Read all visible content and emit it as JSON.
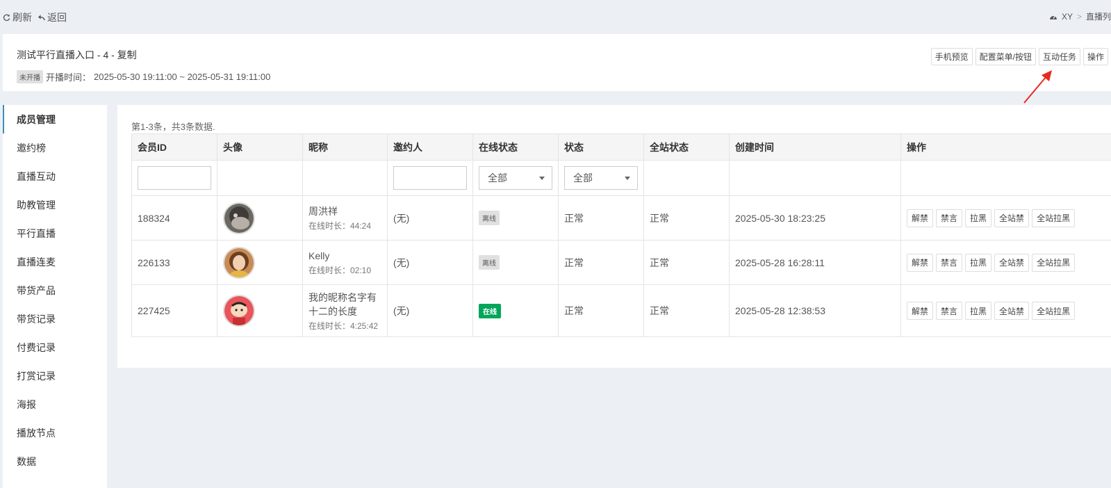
{
  "toolbar": {
    "refresh_label": "刷新",
    "back_label": "返回"
  },
  "breadcrumb": {
    "home": "XY",
    "separator": ">",
    "current": "直播列"
  },
  "live": {
    "title": "测试平行直播入口 - 4 - 复制",
    "status_badge": "未开播",
    "time_label": "开播时间：",
    "time_range": "2025-05-30 19:11:00 ~ 2025-05-31 19:11:00"
  },
  "header_actions": {
    "mobile_preview": "手机预览",
    "config_menu": "配置菜单/按钮",
    "interaction_task": "互动任务",
    "operate": "操作"
  },
  "sidebar": {
    "items": [
      {
        "label": "成员管理"
      },
      {
        "label": "邀约榜"
      },
      {
        "label": "直播互动"
      },
      {
        "label": "助教管理"
      },
      {
        "label": "平行直播"
      },
      {
        "label": "直播连麦"
      },
      {
        "label": "带货产品"
      },
      {
        "label": "带货记录"
      },
      {
        "label": "付费记录"
      },
      {
        "label": "打赏记录"
      },
      {
        "label": "海报"
      },
      {
        "label": "播放节点"
      },
      {
        "label": "数据"
      }
    ]
  },
  "table": {
    "summary": "第1-3条，共3条数据.",
    "columns": {
      "member_id": "会员ID",
      "avatar": "头像",
      "nickname": "昵称",
      "inviter": "邀约人",
      "online_status": "在线状态",
      "status": "状态",
      "site_status": "全站状态",
      "created_at": "创建时间",
      "actions": "操作"
    },
    "filters": {
      "online_status": "全部",
      "status": "全部"
    },
    "actions": {
      "unban": "解禁",
      "mute": "禁言",
      "blacklist": "拉黑",
      "site_ban": "全站禁",
      "site_blacklist": "全站拉黑"
    },
    "rows": [
      {
        "id": "188324",
        "nickname": "周洪祥",
        "duration": "在线时长：44:24",
        "inviter": "(无)",
        "online": "离线",
        "status": "正常",
        "site_status": "正常",
        "created": "2025-05-30 18:23:25"
      },
      {
        "id": "226133",
        "nickname": "Kelly",
        "duration": "在线时长：02:10",
        "inviter": "(无)",
        "online": "离线",
        "status": "正常",
        "site_status": "正常",
        "created": "2025-05-28 16:28:11"
      },
      {
        "id": "227425",
        "nickname": "我的昵称名字有十二的长度",
        "duration": "在线时长：4:25:42",
        "inviter": "(无)",
        "online": "在线",
        "status": "正常",
        "site_status": "正常",
        "created": "2025-05-28 12:38:53"
      }
    ]
  },
  "colors": {
    "online_badge": "#00a65a",
    "accent": "#3c8dbc",
    "annotation_arrow": "#e82a1f",
    "page_bg": "#ecf0f5"
  }
}
